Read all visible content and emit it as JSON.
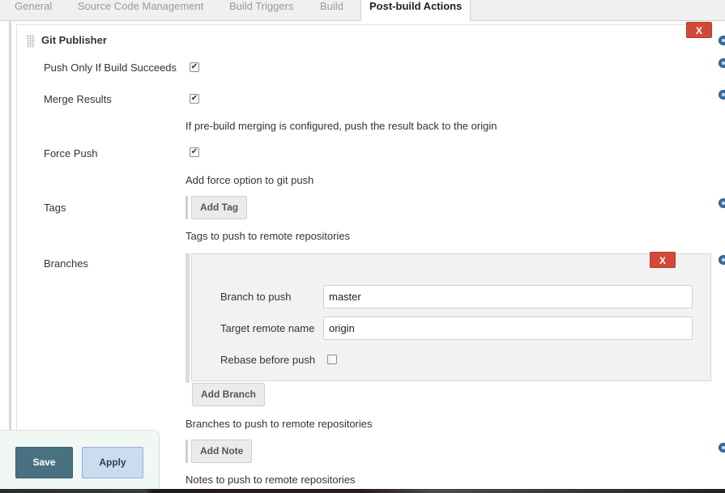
{
  "tabs": [
    {
      "label": "General",
      "active": false
    },
    {
      "label": "Source Code Management",
      "active": false
    },
    {
      "label": "Build Triggers",
      "active": false
    },
    {
      "label": "Build",
      "active": false
    },
    {
      "label": "Post-build Actions",
      "active": true
    }
  ],
  "publisher": {
    "title": "Git Publisher",
    "delete_label": "X",
    "push_only_if_success": {
      "label": "Push Only If Build Succeeds",
      "checked": true
    },
    "merge_results": {
      "label": "Merge Results",
      "checked": true,
      "help": "If pre-build merging is configured, push the result back to the origin"
    },
    "force_push": {
      "label": "Force Push",
      "checked": true,
      "help": "Add force option to git push"
    },
    "tags": {
      "label": "Tags",
      "add_button": "Add Tag",
      "help": "Tags to push to remote repositories"
    },
    "branches": {
      "label": "Branches",
      "delete_label": "X",
      "branch_to_push": {
        "label": "Branch to push",
        "value": "master"
      },
      "target_remote_name": {
        "label": "Target remote name",
        "value": "origin"
      },
      "rebase_before_push": {
        "label": "Rebase before push",
        "checked": false
      },
      "add_button": "Add Branch",
      "help": "Branches to push to remote repositories"
    },
    "notes": {
      "add_button": "Add Note",
      "help": "Notes to push to remote repositories"
    }
  },
  "footer": {
    "save_label": "Save",
    "apply_label": "Apply"
  },
  "colors": {
    "delete": "#d24939",
    "save": "#4a7181",
    "apply": "#c9dcf0",
    "help": "#3a6ea5"
  },
  "icons": {
    "help": "help-icon",
    "drag": "drag-handle-icon",
    "checkmark": "checkmark-icon"
  }
}
